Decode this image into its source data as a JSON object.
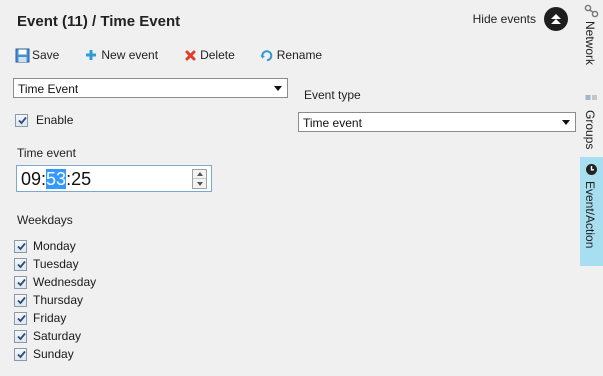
{
  "header": {
    "title": "Event (11) / Time Event",
    "hide_label": "Hide events"
  },
  "toolbar": {
    "save": "Save",
    "new_event": "New event",
    "delete": "Delete",
    "rename": "Rename"
  },
  "event_select": {
    "value": "Time Event"
  },
  "event_type": {
    "label": "Event type",
    "value": "Time event"
  },
  "enable": {
    "label": "Enable",
    "checked": true
  },
  "time_event": {
    "label": "Time event",
    "hours": "09",
    "minutes": "53",
    "seconds": "25"
  },
  "weekdays": {
    "label": "Weekdays",
    "days": [
      {
        "label": "Monday",
        "checked": true
      },
      {
        "label": "Tuesday",
        "checked": true
      },
      {
        "label": "Wednesday",
        "checked": true
      },
      {
        "label": "Thursday",
        "checked": true
      },
      {
        "label": "Friday",
        "checked": true
      },
      {
        "label": "Saturday",
        "checked": true
      },
      {
        "label": "Sunday",
        "checked": true
      }
    ]
  },
  "sidebar": {
    "tabs": [
      {
        "label": "Network",
        "icon": "network-icon",
        "active": false
      },
      {
        "label": "Groups",
        "icon": "groups-icon",
        "active": false
      },
      {
        "label": "Event/Action",
        "icon": "clock-icon",
        "active": true
      }
    ]
  },
  "colors": {
    "active_tab": "#a8dff0",
    "selection": "#3399ff",
    "delete_icon": "#e23b2e",
    "new_icon": "#2e9bd6"
  }
}
